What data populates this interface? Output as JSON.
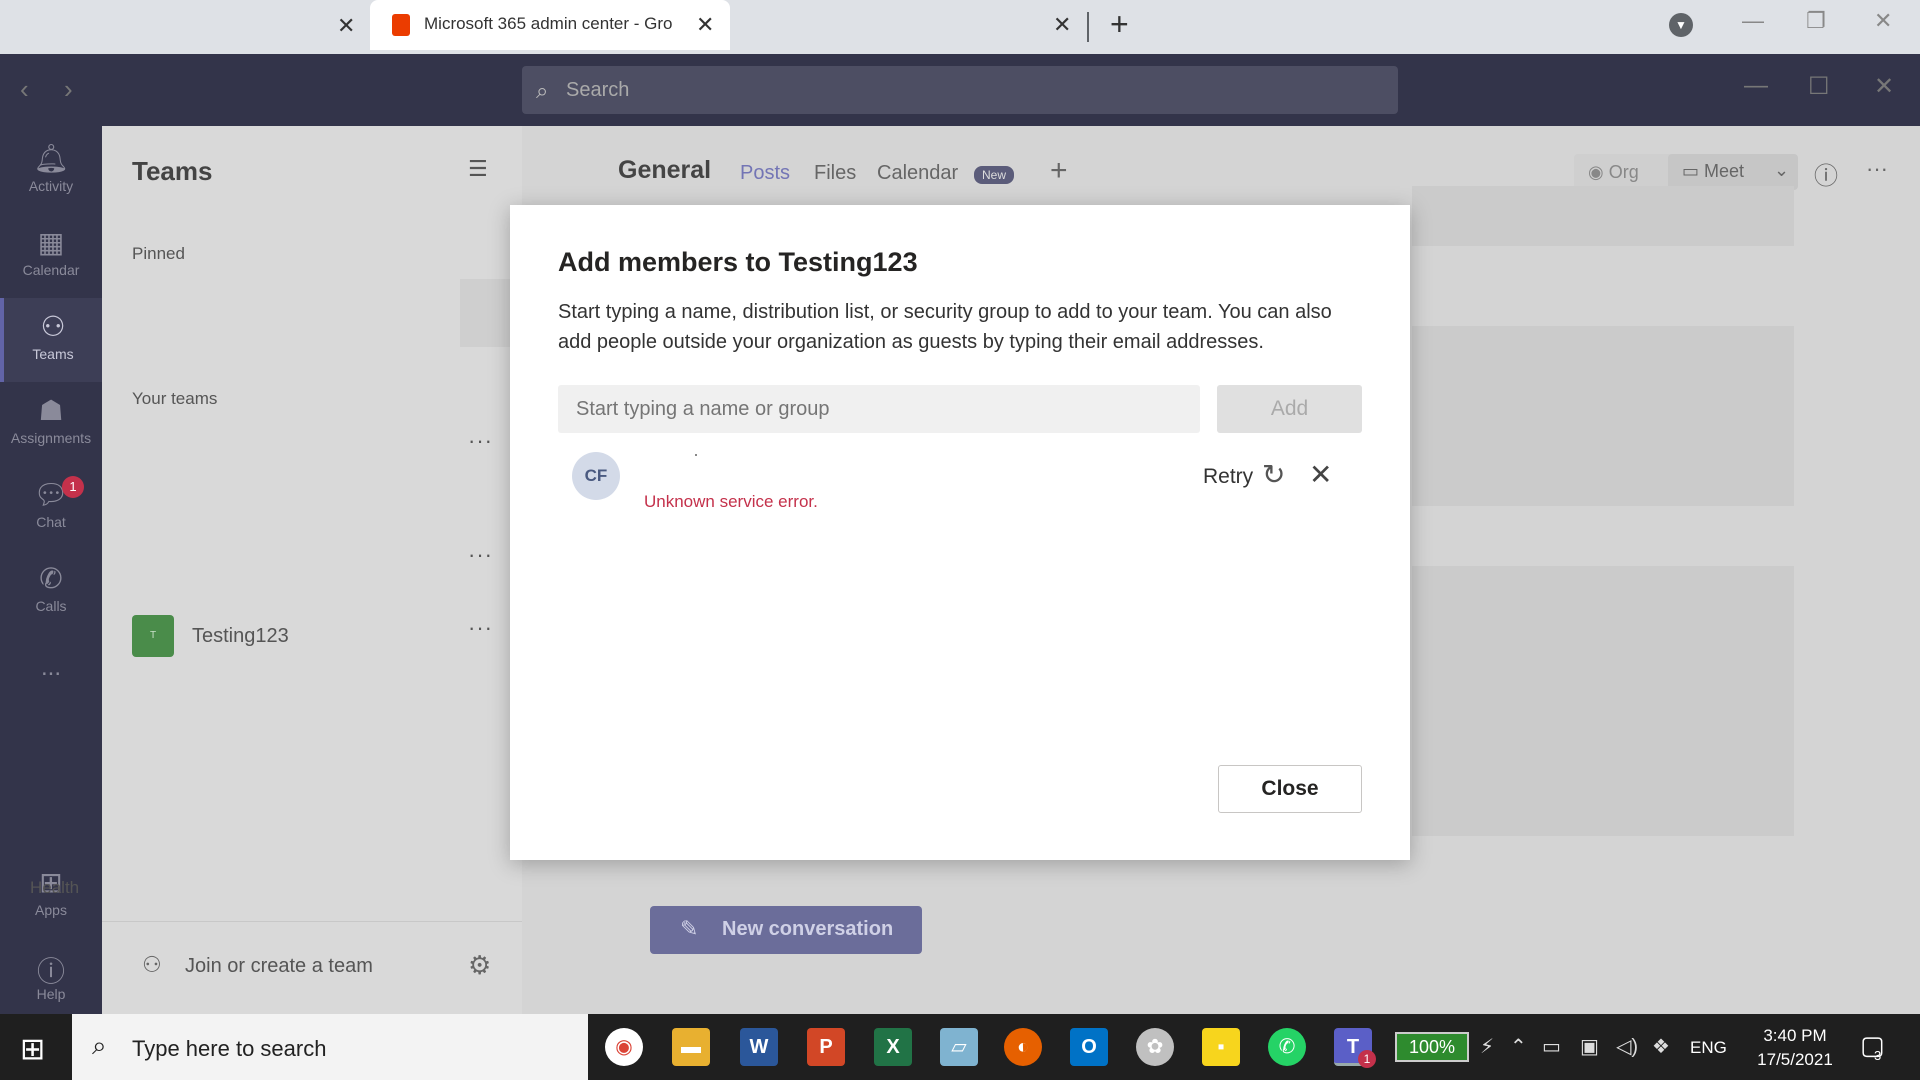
{
  "browser": {
    "active_tab_title": "Microsoft 365 admin center - Gro",
    "new_tab_symbol": "+"
  },
  "teams_top": {
    "search_placeholder": "Search"
  },
  "rail": {
    "items": [
      {
        "label": "Activity",
        "icon": "bell-icon"
      },
      {
        "label": "Calendar",
        "icon": "calendar-icon"
      },
      {
        "label": "Teams",
        "icon": "teams-icon"
      },
      {
        "label": "Assignments",
        "icon": "assignments-icon"
      },
      {
        "label": "Chat",
        "icon": "chat-icon",
        "badge": "1"
      },
      {
        "label": "Calls",
        "icon": "phone-icon"
      },
      {
        "label": "...",
        "icon": "more-icon"
      }
    ],
    "bottom": [
      {
        "label": "Apps",
        "icon": "apps-icon"
      },
      {
        "label": "Help",
        "icon": "help-icon"
      }
    ]
  },
  "teams_panel": {
    "title": "Teams",
    "pinned_label": "Pinned",
    "your_teams_label": "Your teams",
    "team_name": "Testing123",
    "team_avatar": "T",
    "join_label": "Join or create a team",
    "health_label": "Health"
  },
  "channel": {
    "title": "General",
    "tabs": [
      "Posts",
      "Files",
      "Calendar"
    ],
    "new_pill": "New",
    "org_label": "Org",
    "meet_label": "Meet",
    "new_conversation": "New conversation"
  },
  "dialog": {
    "title": "Add members to Testing123",
    "description": "Start typing a name, distribution list, or security group to add to your team. You can also add people outside your organization as guests by typing their email addresses.",
    "input_placeholder": "Start typing a name or group",
    "add_label": "Add",
    "member_initials": "CF",
    "error_text": "Unknown service error.",
    "retry_label": "Retry",
    "close_label": "Close"
  },
  "taskbar": {
    "search_placeholder": "Type here to search",
    "battery": "100%",
    "language": "ENG",
    "time": "3:40 PM",
    "date": "17/5/2021",
    "notifications": "3",
    "teams_badge": "1"
  }
}
